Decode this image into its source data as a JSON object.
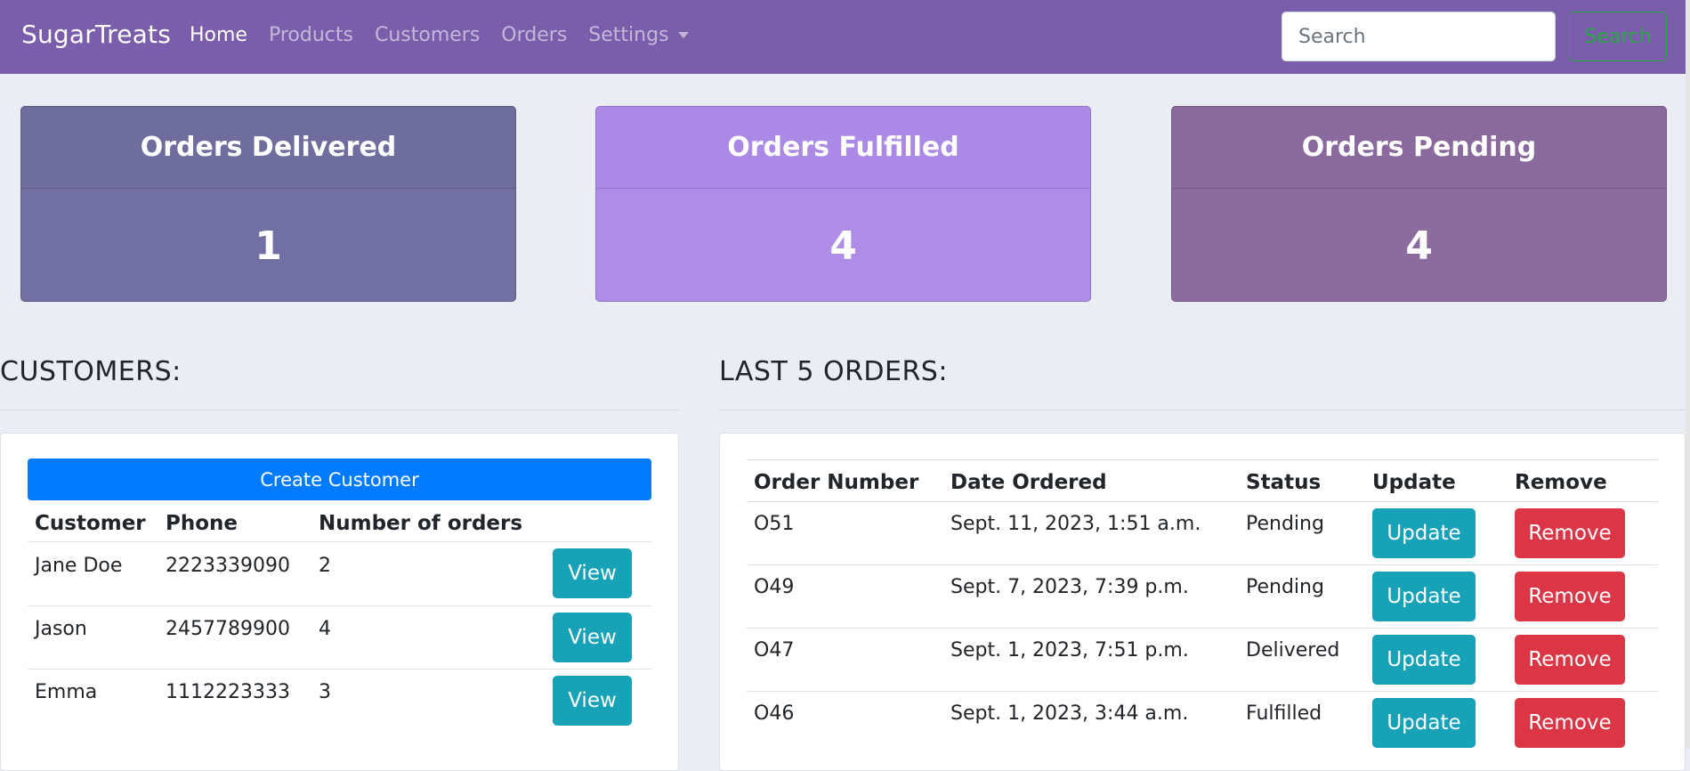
{
  "navbar": {
    "brand": "SugarTreats",
    "links": [
      {
        "label": "Home",
        "active": true
      },
      {
        "label": "Products",
        "active": false
      },
      {
        "label": "Customers",
        "active": false
      },
      {
        "label": "Orders",
        "active": false
      },
      {
        "label": "Settings",
        "active": false,
        "dropdown": true
      }
    ],
    "search_placeholder": "Search",
    "search_button": "Search"
  },
  "stats": [
    {
      "title": "Orders Delivered",
      "value": "1",
      "color": "#6f6d9e"
    },
    {
      "title": "Orders Fulfilled",
      "value": "4",
      "color": "#ae8ce8"
    },
    {
      "title": "Orders Pending",
      "value": "4",
      "color": "#8c6c9e"
    }
  ],
  "customers": {
    "heading": "CUSTOMERS:",
    "create_button": "Create Customer",
    "columns": [
      "Customer",
      "Phone",
      "Number of orders",
      ""
    ],
    "view_label": "View",
    "rows": [
      {
        "name": "Jane Doe",
        "phone": "2223339090",
        "orders": "2"
      },
      {
        "name": "Jason",
        "phone": "2457789900",
        "orders": "4"
      },
      {
        "name": "Emma",
        "phone": "1112223333",
        "orders": "3"
      }
    ]
  },
  "orders": {
    "heading": "LAST 5 ORDERS:",
    "columns": [
      "Order Number",
      "Date Ordered",
      "Status",
      "Update",
      "Remove"
    ],
    "update_label": "Update",
    "remove_label": "Remove",
    "rows": [
      {
        "number": "O51",
        "date": "Sept. 11, 2023, 1:51 a.m.",
        "status": "Pending"
      },
      {
        "number": "O49",
        "date": "Sept. 7, 2023, 7:39 p.m.",
        "status": "Pending"
      },
      {
        "number": "O47",
        "date": "Sept. 1, 2023, 7:51 p.m.",
        "status": "Delivered"
      },
      {
        "number": "O46",
        "date": "Sept. 1, 2023, 3:44 a.m.",
        "status": "Fulfilled"
      }
    ]
  },
  "colors": {
    "navbar": "#7b5eab",
    "page_bg": "#eaedf4",
    "primary": "#007bff",
    "info": "#17a2b8",
    "danger": "#dc3545",
    "success": "#28a745"
  }
}
